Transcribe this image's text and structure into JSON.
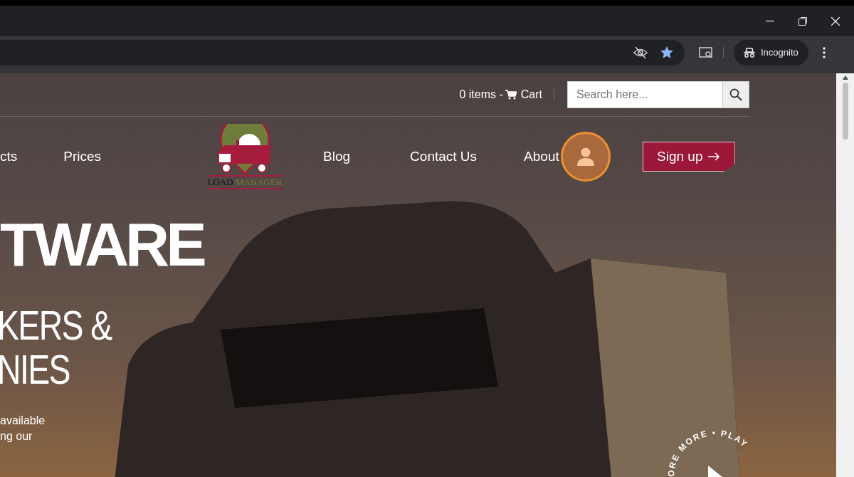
{
  "browser": {
    "profile_label": "Incognito"
  },
  "top_bar": {
    "cart_count": "0 items -",
    "cart_label": "Cart",
    "search": {
      "placeholder": "Search here..."
    }
  },
  "nav": {
    "left_items": [
      {
        "label": "cts"
      },
      {
        "label": "Prices"
      }
    ],
    "logo": {
      "word_1": "LOAD",
      "word_2": "MANAGER"
    },
    "right_items": [
      {
        "label": "Blog"
      },
      {
        "label": "Contact Us"
      },
      {
        "label": "About"
      }
    ],
    "signup": {
      "label": "Sign up"
    }
  },
  "hero": {
    "headline": "TWARE",
    "subheadline_lines": [
      "KERS &",
      "NIES"
    ],
    "text_lines": [
      "available",
      "ng our"
    ],
    "circle_text": "ORE MORE • PLAY"
  }
}
